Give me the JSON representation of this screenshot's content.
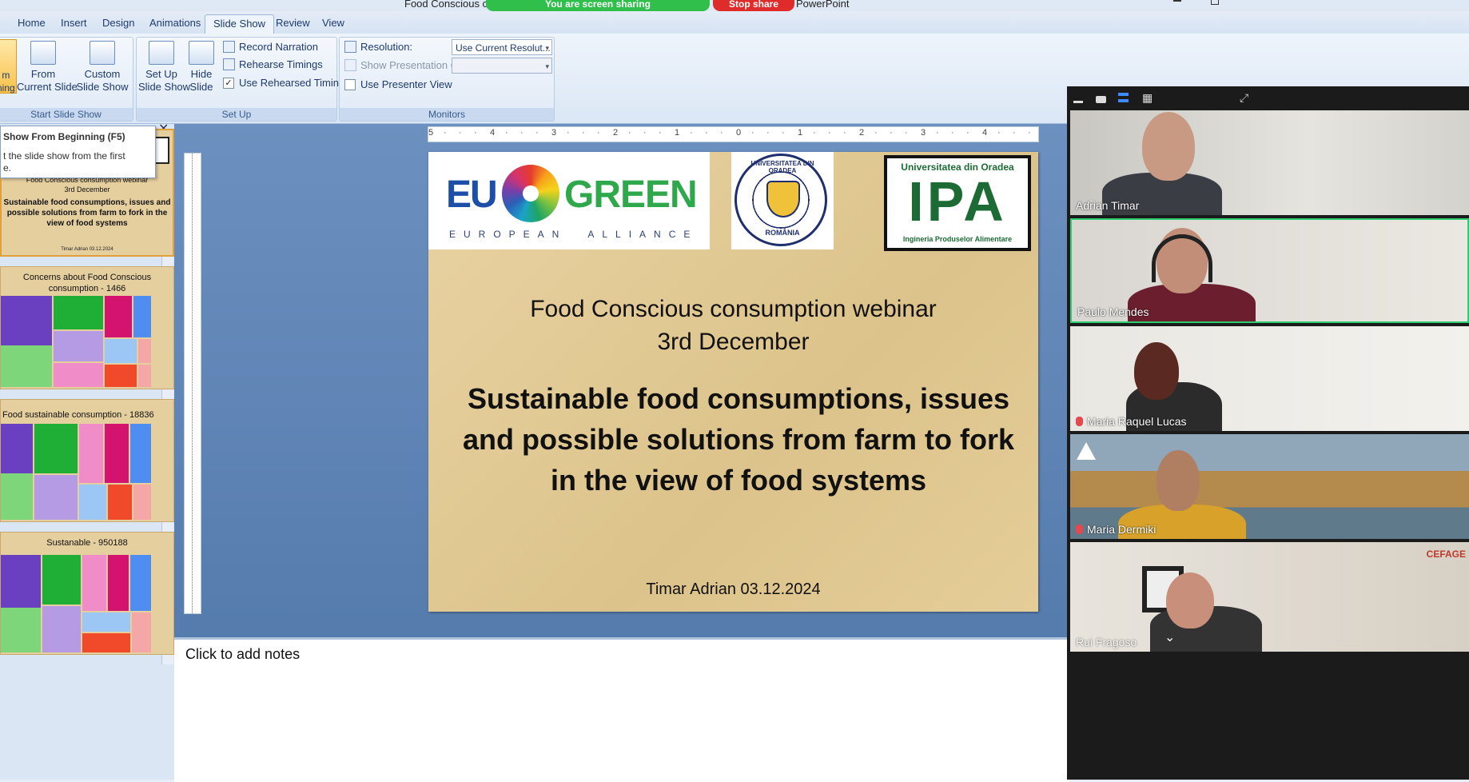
{
  "window": {
    "title_left": "Food Conscious co",
    "title_right": "PowerPoint",
    "sharing_text": "You are screen sharing",
    "stop_share": "Stop share"
  },
  "tabs": [
    "Home",
    "Insert",
    "Design",
    "Animations",
    "Slide Show",
    "Review",
    "View"
  ],
  "active_tab": "Slide Show",
  "ribbon": {
    "start": {
      "label": "Start Slide Show",
      "from_beginning": "m\nning",
      "from_current": "From\nCurrent Slide",
      "custom": "Custom\nSlide Show"
    },
    "setup": {
      "label": "Set Up",
      "setup_show": "Set Up\nSlide Show",
      "hide_slide": "Hide\nSlide",
      "record": "Record Narration",
      "rehearse": "Rehearse Timings",
      "use_rehearsed": "Use Rehearsed Timings"
    },
    "monitors": {
      "label": "Monitors",
      "resolution_label": "Resolution:",
      "resolution_value": "Use Current Resolut...",
      "show_on_label": "Show Presentation On:",
      "presenter_view": "Use Presenter View"
    }
  },
  "tooltip": {
    "title": "Show From Beginning (F5)",
    "body": "t the slide show from the first\ne."
  },
  "thumbs": [
    {
      "line1": "Food Conscious consumption webinar",
      "line2": "3rd December",
      "title": "Sustainable food consumptions, issues and possible solutions from farm to fork in the view of food systems",
      "footer": "Timar Adrian 03.12.2024"
    },
    {
      "caption": "Concerns about Food Conscious consumption  - 1466"
    },
    {
      "caption": "Food sustainable  consumption  - 18836"
    },
    {
      "caption": "Sustanable - 950188"
    }
  ],
  "ruler_marks": [
    "5",
    "4",
    "3",
    "2",
    "1",
    "0",
    "1",
    "2",
    "3",
    "4"
  ],
  "slide": {
    "logo_eu": "EU",
    "logo_green": "GREEN",
    "logo_alliance": "EUROPEAN  ALLIANCE",
    "uo_ring": "UNIVERSITATEA DIN ORADEA",
    "uo_bottom": "ROMÂNIA",
    "ipa_top": "Universitatea din Oradea",
    "ipa_big": "IPA",
    "ipa_bottom": "Ingineria Produselor Alimentare",
    "heading1": "Food Conscious consumption webinar",
    "heading2": "3rd December",
    "title": "Sustainable food consumptions, issues and possible solutions from farm to fork in the view of food systems",
    "footer": "Timar Adrian 03.12.2024"
  },
  "notes_placeholder": "Click to add notes",
  "participants": [
    {
      "name": "Adrian Timar",
      "muted": false
    },
    {
      "name": "Paulo Mendes",
      "muted": false
    },
    {
      "name": "Maria Raquel Lucas",
      "muted": true
    },
    {
      "name": "Maria Dermiki",
      "muted": true
    },
    {
      "name": "Rui Fragoso",
      "muted": false
    }
  ],
  "cefage_label": "CEFAGE",
  "colors": {
    "slide_bg": "#e2c994",
    "share_green": "#2fbf4a",
    "stop_red": "#e02b2b",
    "active_speaker": "#2ecc71"
  }
}
